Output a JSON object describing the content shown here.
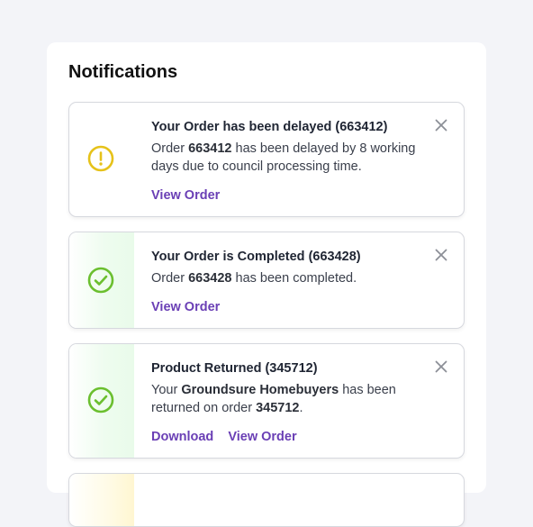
{
  "panel": {
    "title": "Notifications"
  },
  "notifications": [
    {
      "status": "warning",
      "icon": "exclamation-circle-icon",
      "title": "Your Order has been delayed (663412)",
      "body": {
        "p1": "Order ",
        "b1": "663412",
        "p2": " has been delayed by 8 working days due to council processing time."
      },
      "actions": [
        "View Order"
      ]
    },
    {
      "status": "success",
      "icon": "check-circle-icon",
      "title": "Your Order is Completed (663428)",
      "body": {
        "p1": "Order ",
        "b1": "663428",
        "p2": " has been completed."
      },
      "actions": [
        "View Order"
      ]
    },
    {
      "status": "success",
      "icon": "check-circle-icon",
      "title": "Product Returned (345712)",
      "body": {
        "p1": "Your ",
        "b1": "Groundsure Homebuyers",
        "p2": " has been returned on order ",
        "b2": "345712",
        "p3": "."
      },
      "actions": [
        "Download",
        "View Order"
      ]
    }
  ],
  "colors": {
    "link": "#6a3fb5",
    "warning": "#e6c21a",
    "success": "#6bbf2f",
    "close": "#8c8f97"
  }
}
